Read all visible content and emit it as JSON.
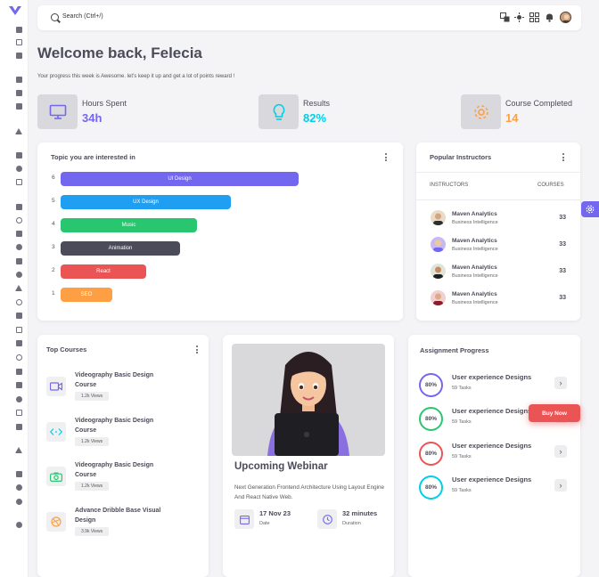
{
  "search": {
    "placeholder": "Search (Ctrl+/)"
  },
  "header": {
    "title": "Welcome back, Felecia",
    "subtitle": "Your progress this week is Awesome. let's keep it up and get a lot of points reward !"
  },
  "stats": [
    {
      "label": "Hours Spent",
      "value": "34h",
      "color": "#7367f0",
      "icon": "monitor-icon"
    },
    {
      "label": "Results",
      "value": "82%",
      "color": "#00cfe8",
      "icon": "lightbulb-icon"
    },
    {
      "label": "Course Completed",
      "value": "14",
      "color": "#ff9f43",
      "icon": "gear-icon"
    }
  ],
  "topics": {
    "title": "Topic you are interested in",
    "bars": [
      {
        "num": "6",
        "label": "UI Design",
        "color": "#7367f0"
      },
      {
        "num": "5",
        "label": "UX Design",
        "color": "#1e9ff2"
      },
      {
        "num": "4",
        "label": "Music",
        "color": "#28c76f"
      },
      {
        "num": "3",
        "label": "Animation",
        "color": "#4b4b5a"
      },
      {
        "num": "2",
        "label": "React",
        "color": "#ea5455"
      },
      {
        "num": "1",
        "label": "SEO",
        "color": "#ff9f43"
      }
    ]
  },
  "instructors": {
    "title": "Popular Instructors",
    "col_instructors": "INSTRUCTORS",
    "col_courses": "COURSES",
    "rows": [
      {
        "name": "Maven Analytics",
        "sub": "Business Intelligence",
        "count": "33"
      },
      {
        "name": "Maven Analytics",
        "sub": "Business Intelligence",
        "count": "33"
      },
      {
        "name": "Maven Analytics",
        "sub": "Business Intelligence",
        "count": "33"
      },
      {
        "name": "Maven Analytics",
        "sub": "Business Intelligence",
        "count": "33"
      }
    ]
  },
  "top_courses": {
    "title": "Top Courses",
    "items": [
      {
        "name": "Videography Basic Design Course",
        "views": "1.2k Views",
        "icon": "video-icon",
        "color": "#7367f0"
      },
      {
        "name": "Videography Basic Design Course",
        "views": "1.2k Views",
        "icon": "code-icon",
        "color": "#00cfe8"
      },
      {
        "name": "Videography Basic Design Course",
        "views": "1.2k Views",
        "icon": "camera-icon",
        "color": "#28c76f"
      },
      {
        "name": "Advance Dribble Base Visual Design",
        "views": "3.9k Views",
        "icon": "dribbble-icon",
        "color": "#ff9f43"
      }
    ]
  },
  "webinar": {
    "title": "Upcoming Webinar",
    "desc": "Next Generation Frontend Architecture Using Layout Engine And React Native Web.",
    "date_value": "17 Nov 23",
    "date_label": "Date",
    "duration_value": "32 minutes",
    "duration_label": "Duration"
  },
  "assignment": {
    "title": "Assignment Progress",
    "items": [
      {
        "percent": "80%",
        "name": "User experience Designs",
        "tasks": "59 Tasks",
        "color": "#7367f0"
      },
      {
        "percent": "80%",
        "name": "User experience Designs",
        "tasks": "59 Tasks",
        "color": "#28c76f"
      },
      {
        "percent": "80%",
        "name": "User experience Designs",
        "tasks": "59 Tasks",
        "color": "#ea5455"
      },
      {
        "percent": "80%",
        "name": "User experience Designs",
        "tasks": "59 Tasks",
        "color": "#00cfe8"
      }
    ]
  },
  "buy_now": "Buy Now"
}
